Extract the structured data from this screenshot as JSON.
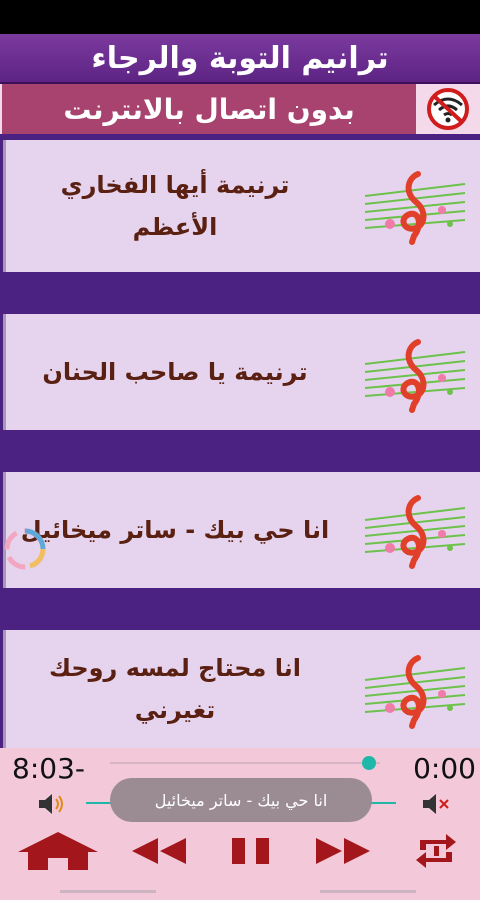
{
  "app": {
    "title": "ترانيم التوبة والرجاء",
    "subtitle": "بدون اتصال بالانترنت",
    "wifi_icon": "no-wifi-icon"
  },
  "colors": {
    "title_bg": "#6a2d92",
    "subtitle_bg": "#a7436e",
    "list_bg": "#4b2282",
    "item_bg": "#e6d4ee",
    "item_text": "#5a2012",
    "player_bg": "#f3c9d9",
    "accent": "#1fb8a8",
    "control": "#a3171c"
  },
  "songs": [
    {
      "title": "ترنيمة أيها الفخاري الأعظم",
      "icon": "music-note-icon"
    },
    {
      "title": "ترنيمة يا صاحب الحنان",
      "icon": "music-note-icon"
    },
    {
      "title": "انا حي بيك - ساتر ميخائيل",
      "icon": "music-note-icon"
    },
    {
      "title": "انا محتاج لمسه روحك تغيرني",
      "icon": "music-note-icon"
    }
  ],
  "player": {
    "remaining_time": "8:03-",
    "elapsed_time": "0:00",
    "now_playing_toast": "انا حي بيك - ساتر ميخائيل",
    "seek_progress": 0.96,
    "icons": {
      "volume_up": "volume-up-icon",
      "volume_mute": "volume-mute-icon",
      "home": "home-icon",
      "previous": "rewind-icon",
      "pause": "pause-icon",
      "next": "fast-forward-icon",
      "repeat": "repeat-icon"
    }
  }
}
